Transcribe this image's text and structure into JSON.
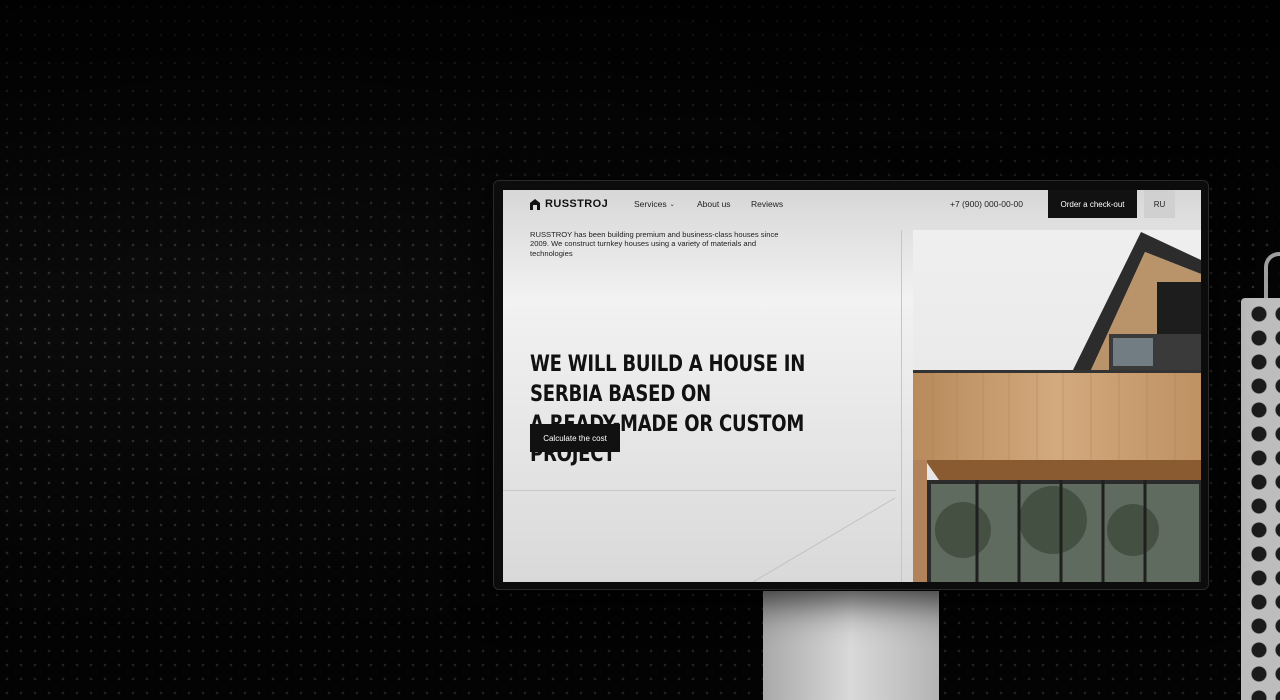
{
  "site": {
    "logo_text": "RUSSTROJ",
    "nav": {
      "services": "Services",
      "about": "About us",
      "reviews": "Reviews"
    },
    "phone": "+7 (900) 000-00-00",
    "order_button": "Order a check-out",
    "language": "RU"
  },
  "hero": {
    "intro": "RUSSTROY has been building premium and business-class houses since 2009. We construct turnkey houses using a variety of materials and technologies",
    "headline_line1": "WE WILL BUILD A HOUSE IN SERBIA BASED ON",
    "headline_line2": "A READY-MADE OR CUSTOM PROJECT",
    "cta": "Calculate the cost"
  },
  "icons": [
    "logo-house-icon",
    "chevron-down-icon"
  ],
  "colors": {
    "dark": "#111111",
    "wood": "#c69a6b"
  }
}
